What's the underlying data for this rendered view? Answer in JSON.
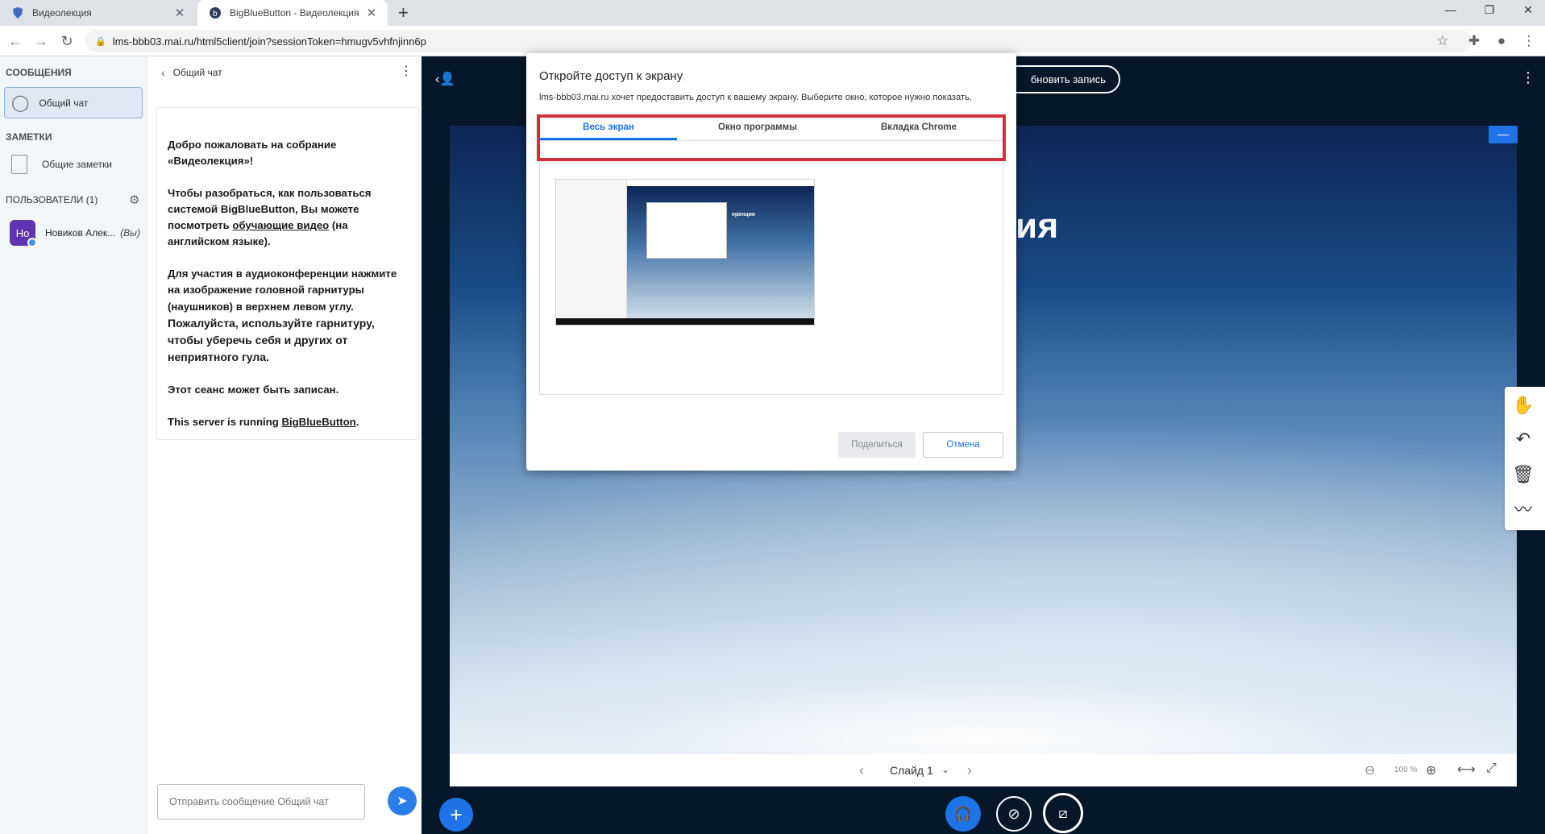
{
  "browser": {
    "tabs": [
      {
        "title": "Видеолекция"
      },
      {
        "title": "BigBlueButton - Видеолекция"
      }
    ],
    "url": "lms-bbb03.mai.ru/html5client/join?sessionToken=hmugv5vhfnjinn6p"
  },
  "sidebar": {
    "messages_title": "СООБЩЕНИЯ",
    "public_chat": "Общий чат",
    "notes_title": "ЗАМЕТКИ",
    "shared_notes": "Общие заметки",
    "users_title": "ПОЛЬЗОВАТЕЛИ (1)",
    "user": {
      "initials": "Но",
      "name": "Новиков Алек...",
      "you": "(Вы)"
    }
  },
  "chat": {
    "header": "Общий чат",
    "welcome": {
      "p1_a": "Добро пожаловать на собрание «",
      "p1_b": "Видеолекция",
      "p1_c": "»!",
      "p2_a": "Чтобы разобраться, как пользоваться системой BigBlueButton, Вы можете посмотреть ",
      "p2_link": "обучающие видео",
      "p2_b": " (на английском языке).",
      "p3_a": "Для участия в аудиоконференции нажмите на изображение головной гарнитуры (наушников) в верхнем левом углу.",
      "p3_b": " Пожалуйста, используйте гарнитуру, чтобы уберечь себя и других от неприятного гула.",
      "p4": "Этот сеанс может быть записан.",
      "p5_a": "This server is running ",
      "p5_link": "BigBlueButton",
      "p5_b": "."
    },
    "input_placeholder": "Отправить сообщение Общий чат"
  },
  "main": {
    "record_button": "бновить запись",
    "slide_title": "еренция",
    "slide_label": "Слайд 1",
    "zoom": "100 %"
  },
  "dialog": {
    "title": "Откройте доступ к экрану",
    "subtitle": "lms-bbb03.mai.ru хочет предоставить доступ к вашему экрану. Выберите окно, которое нужно показать.",
    "tabs": [
      "Весь экран",
      "Окно программы",
      "Вкладка Chrome"
    ],
    "thumb_text": "еренция",
    "share": "Поделиться",
    "cancel": "Отмена"
  },
  "colors": {
    "accent": "#1e73e6",
    "highlight_border": "#d32f3a",
    "main_bg": "#06172a"
  },
  "icons": [
    "shield-favicon-icon",
    "bbb-favicon-icon",
    "close-icon",
    "plus-icon",
    "back-icon",
    "forward-icon",
    "reload-icon",
    "lock-icon",
    "star-icon",
    "extensions-icon",
    "profile-icon",
    "menu-icon",
    "chat-icon",
    "notes-icon",
    "gear-icon",
    "send-icon",
    "user-list-icon",
    "hand-icon",
    "undo-icon",
    "trash-icon",
    "whiteboard-icon",
    "headset-icon",
    "video-off-icon",
    "screenshare-icon"
  ]
}
